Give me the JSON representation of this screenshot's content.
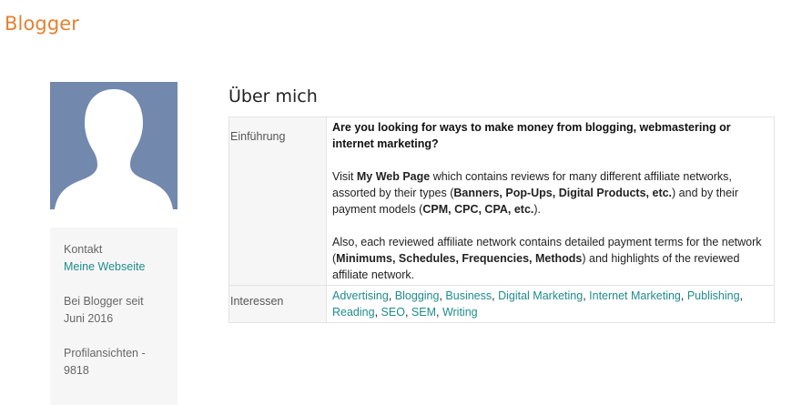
{
  "header": {
    "brand": "Blogger"
  },
  "profile": {
    "avatar_icon": "default-person-silhouette-icon",
    "avatar_color": "#7288ad",
    "contact_label": "Kontakt",
    "website_link": "Meine Webseite",
    "member_since_label": "Bei Blogger seit",
    "member_since_date": "Juni 2016",
    "views_label": "Profilansichten -",
    "views_count": "9818"
  },
  "about": {
    "title": "Über mich",
    "intro_label": "Einführung",
    "intro": {
      "lead": "Are you looking for ways to make money from blogging, webmastering or internet marketing?",
      "p2": [
        "Visit ",
        "My Web Page",
        " which contains reviews for many different affiliate networks, assorted by their types (",
        "Banners, Pop-Ups, Digital Products, etc.",
        ") and by their payment models (",
        "CPM, CPC, CPA, etc.",
        ")."
      ],
      "p3": [
        "Also, each reviewed affiliate network contains detailed payment terms for the network (",
        "Minimums, Schedules, Frequencies, Methods",
        ") and highlights of the reviewed affiliate network."
      ]
    },
    "interests_label": "Interessen",
    "interests": [
      "Advertising",
      "Blogging",
      "Business",
      "Digital Marketing",
      "Internet Marketing",
      "Publishing",
      "Reading",
      "SEO",
      "SEM",
      "Writing"
    ]
  },
  "colors": {
    "brand": "#e5812f",
    "link": "#1f8c8c",
    "sidebar_bg": "#f6f6f6"
  }
}
